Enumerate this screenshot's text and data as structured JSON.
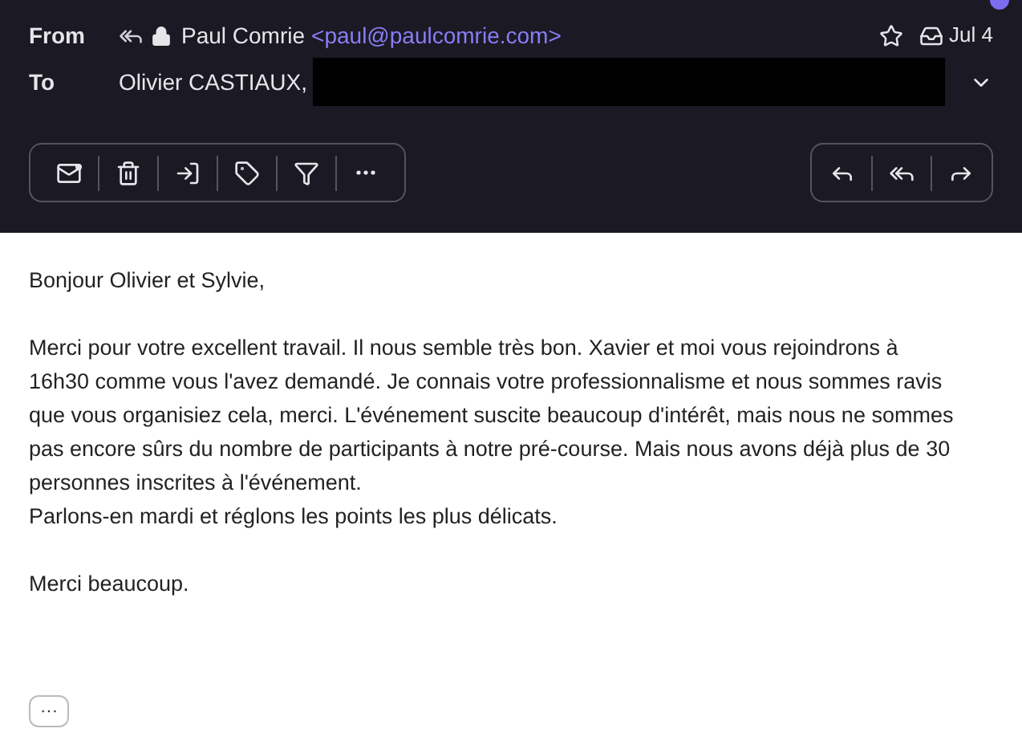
{
  "header": {
    "from_label": "From",
    "sender_name": "Paul Comrie",
    "sender_email": "<paul@paulcomrie.com>",
    "starred": false,
    "date": "Jul 4",
    "to_label": "To",
    "recipient": "Olivier CASTIAUX,"
  },
  "body": {
    "paragraphs": [
      {
        "lines": [
          "Bonjour Olivier et Sylvie,"
        ]
      },
      {
        "lines": [
          "Merci pour votre excellent travail. Il nous semble très bon. Xavier et moi vous rejoindrons à 16h30 comme vous l'avez demandé. Je connais votre professionnalisme et nous sommes ravis que vous organisiez cela, merci. L'événement suscite beaucoup d'intérêt, mais nous ne sommes pas encore sûrs du nombre de participants à notre pré-course. Mais nous avons déjà plus de 30 personnes inscrites à l'événement.",
          "Parlons-en mardi et réglons les points les plus délicats."
        ]
      },
      {
        "lines": [
          "Merci beaucoup."
        ]
      }
    ],
    "more_label": "···"
  }
}
